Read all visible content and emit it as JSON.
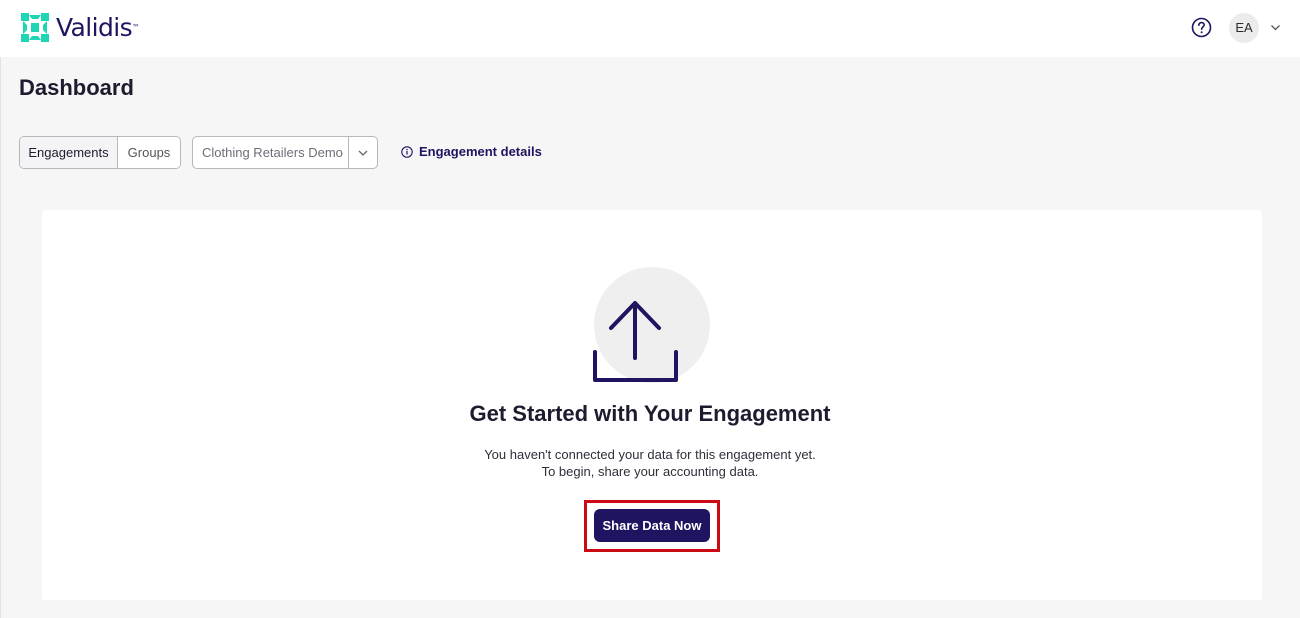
{
  "header": {
    "brand": "Validis",
    "brand_tm": "™",
    "help_icon": "question-circle-icon",
    "user_initials": "EA",
    "user_menu_icon": "chevron-down-icon"
  },
  "page": {
    "title": "Dashboard"
  },
  "toolbar": {
    "segments": [
      {
        "label": "Engagements",
        "selected": true
      },
      {
        "label": "Groups",
        "selected": false
      }
    ],
    "select": {
      "value": "Clothing Retailers Demo",
      "icon": "chevron-down-icon"
    },
    "details_link": {
      "label": "Engagement details",
      "icon": "info-circle-icon"
    }
  },
  "empty_state": {
    "icon": "upload-icon",
    "title": "Get Started with Your Engagement",
    "line1": "You haven't connected your data for this engagement yet.",
    "line2": "To begin, share your accounting data.",
    "button_label": "Share Data Now"
  },
  "colors": {
    "brand_navy": "#1e1460",
    "brand_teal": "#1fd6b4",
    "highlight_red": "#cc0a14",
    "background": "#f6f6f6"
  }
}
